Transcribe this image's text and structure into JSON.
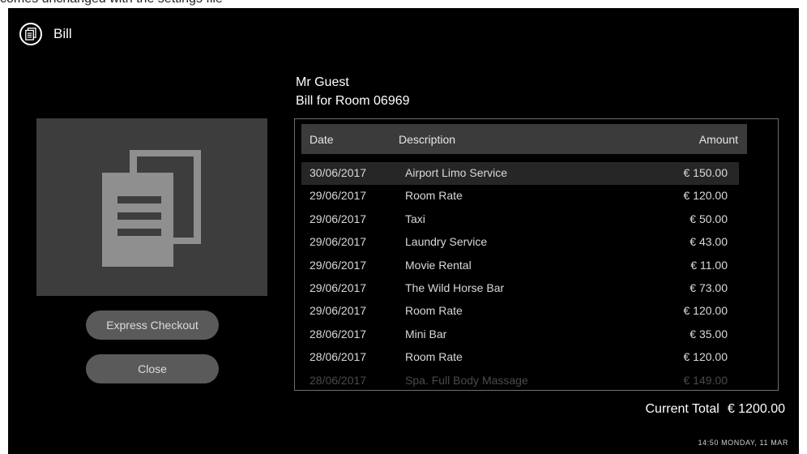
{
  "caption": "comes unchanged with the settings file",
  "header": {
    "title": "Bill"
  },
  "buttons": {
    "express_checkout": "Express Checkout",
    "close": "Close"
  },
  "guest": {
    "name": "Mr Guest",
    "room_line": "Bill for Room 06969"
  },
  "table": {
    "columns": {
      "date": "Date",
      "description": "Description",
      "amount": "Amount"
    },
    "rows": [
      {
        "date": "30/06/2017",
        "description": "Airport Limo Service",
        "amount": "€ 150.00"
      },
      {
        "date": "29/06/2017",
        "description": "Room Rate",
        "amount": "€ 120.00"
      },
      {
        "date": "29/06/2017",
        "description": "Taxi",
        "amount": "€ 50.00"
      },
      {
        "date": "29/06/2017",
        "description": "Laundry Service",
        "amount": "€ 43.00"
      },
      {
        "date": "29/06/2017",
        "description": "Movie Rental",
        "amount": "€ 11.00"
      },
      {
        "date": "29/06/2017",
        "description": "The Wild Horse Bar",
        "amount": "€ 73.00"
      },
      {
        "date": "29/06/2017",
        "description": "Room Rate",
        "amount": "€ 120.00"
      },
      {
        "date": "28/06/2017",
        "description": "Mini Bar",
        "amount": "€ 35.00"
      },
      {
        "date": "28/06/2017",
        "description": "Room Rate",
        "amount": "€ 120.00"
      },
      {
        "date": "28/06/2017",
        "description": "Spa. Full Body Massage",
        "amount": "€ 149.00"
      }
    ]
  },
  "total": {
    "label": "Current Total",
    "value": "€ 1200.00"
  },
  "clock": "14:50 MONDAY, 11 MAR",
  "icons": {
    "header": "document-icon",
    "panel": "documents-icon"
  },
  "colors": {
    "background": "#000000",
    "panel": "#3d3d3d",
    "button": "#5a5a5a",
    "header_row": "#3b3b3b"
  }
}
